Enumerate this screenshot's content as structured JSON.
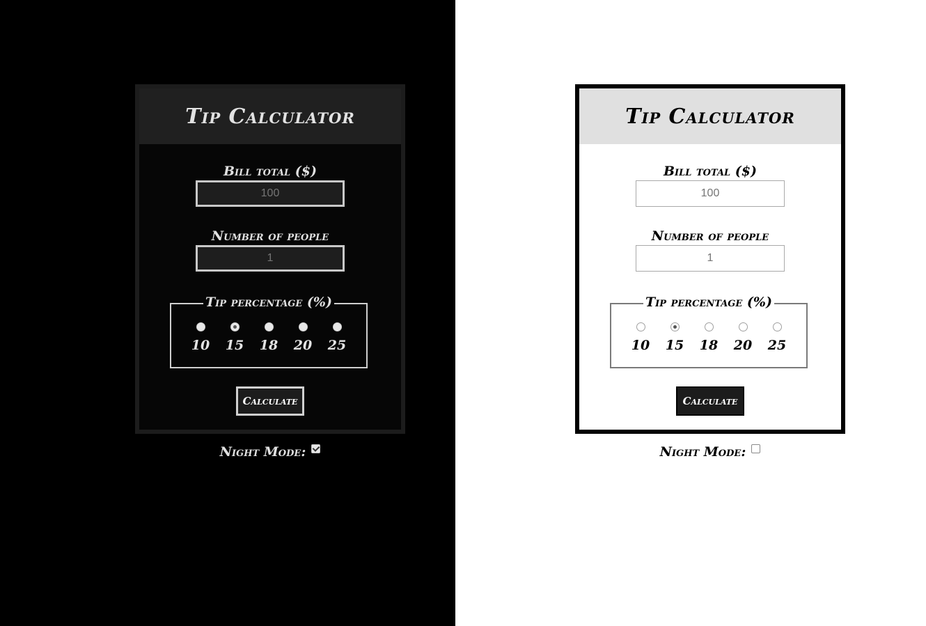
{
  "colors": {
    "dark_bg": "#000000",
    "light_bg": "#ffffff",
    "button_bg": "#1c1c1c"
  },
  "dark": {
    "title": "Tip Calculator",
    "bill_label": "Bill total ($)",
    "bill_placeholder": "100",
    "people_label": "Number of people",
    "people_placeholder": "1",
    "tip_legend": "Tip percentage (%)",
    "tip_options": [
      "10",
      "15",
      "18",
      "20",
      "25"
    ],
    "selected_tip": "15",
    "calculate_label": "Calculate",
    "night_mode_label": "Night Mode:",
    "night_mode_checked": true
  },
  "light": {
    "title": "Tip Calculator",
    "bill_label": "Bill total ($)",
    "bill_placeholder": "100",
    "people_label": "Number of people",
    "people_placeholder": "1",
    "tip_legend": "Tip percentage (%)",
    "tip_options": [
      "10",
      "15",
      "18",
      "20",
      "25"
    ],
    "selected_tip": "15",
    "calculate_label": "Calculate",
    "night_mode_label": "Night Mode:",
    "night_mode_checked": false
  }
}
